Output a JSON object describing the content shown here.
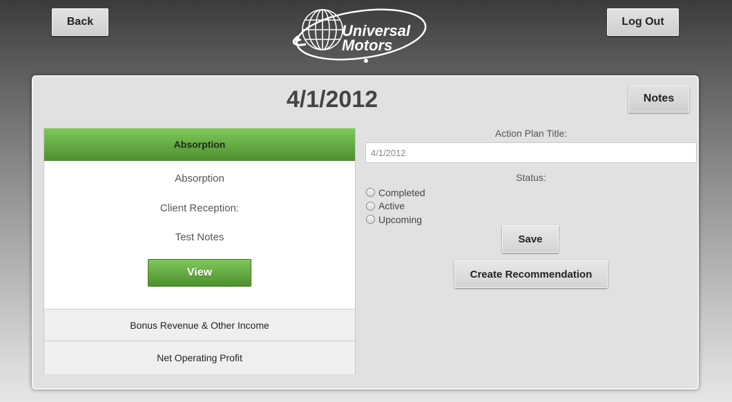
{
  "header": {
    "back_label": "Back",
    "logout_label": "Log Out",
    "logo": {
      "line1": "Universal",
      "line2": "Motors"
    }
  },
  "main": {
    "title": "4/1/2012",
    "notes_label": "Notes",
    "accordion": {
      "active": {
        "header": "Absorption",
        "lines": [
          "Absorption",
          "Client Reception:",
          "Test Notes"
        ],
        "view_label": "View"
      },
      "items": [
        "Bonus Revenue & Other Income",
        "Net Operating Profit"
      ]
    },
    "form": {
      "title_label": "Action Plan Title:",
      "title_value": "4/1/2012",
      "status_label": "Status:",
      "status_options": [
        "Completed",
        "Active",
        "Upcoming"
      ],
      "save_label": "Save",
      "create_label": "Create Recommendation"
    }
  },
  "colors": {
    "accent_green": "#6aae46",
    "panel_bg": "#e1e1e1",
    "title_gray": "#444444"
  }
}
